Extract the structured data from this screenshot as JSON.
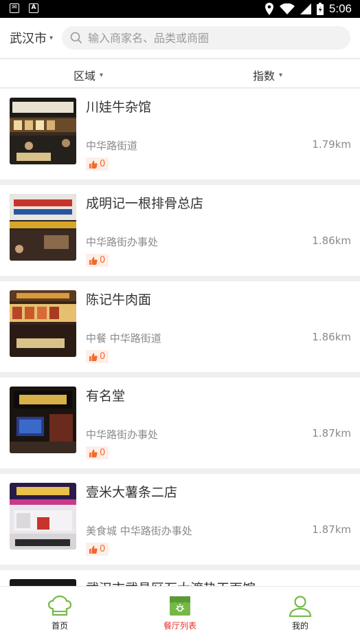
{
  "status_bar": {
    "time": "5:06"
  },
  "header": {
    "city": "武汉市",
    "search_placeholder": "输入商家名、品类或商圈"
  },
  "filters": [
    {
      "label": "区域"
    },
    {
      "label": "指数"
    }
  ],
  "restaurants": [
    {
      "name": "川娃牛杂馆",
      "tags": "中华路街道",
      "distance": "1.79km",
      "likes": "0"
    },
    {
      "name": "成明记一根排骨总店",
      "tags": "中华路街办事处",
      "distance": "1.86km",
      "likes": "0"
    },
    {
      "name": "陈记牛肉面",
      "tags": "中餐   中华路街道",
      "distance": "1.86km",
      "likes": "0"
    },
    {
      "name": "有名堂",
      "tags": "中华路街办事处",
      "distance": "1.87km",
      "likes": "0"
    },
    {
      "name": "壹米大薯条二店",
      "tags": "美食城   中华路街办事处",
      "distance": "1.87km",
      "likes": "0"
    },
    {
      "name": "武汉市武昌区石大渡热干面馆",
      "tags": "",
      "distance": "",
      "likes": ""
    }
  ],
  "tabbar": [
    {
      "label": "首页",
      "icon": "chef-hat-icon"
    },
    {
      "label": "餐厅列表",
      "icon": "storefront-icon",
      "active": true
    },
    {
      "label": "我的",
      "icon": "user-icon"
    }
  ],
  "colors": {
    "accent": "#76b947",
    "active_text": "#e8312a",
    "like": "#f06a2e"
  }
}
